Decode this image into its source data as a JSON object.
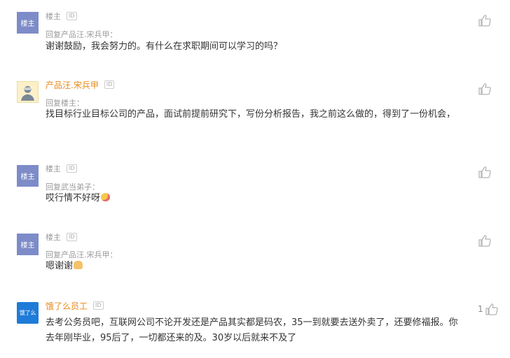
{
  "comments": [
    {
      "avatar_label": "楼主",
      "name": "楼主",
      "id_badge": "ID",
      "reply_to": "回复产品汪.宋兵甲：",
      "text": "谢谢鼓励，我会努力的。有什么在求职期间可以学习的吗？",
      "likes": ""
    },
    {
      "avatar_label": "",
      "name": "产品汪.宋兵甲",
      "id_badge": "ID",
      "reply_to": "回复楼主：",
      "text": "找目标行业目标公司的产品，面试前提前研究下，写份分析报告，我之前这么做的，得到了一份机会，",
      "likes": ""
    },
    {
      "avatar_label": "楼主",
      "name": "楼主",
      "id_badge": "ID",
      "reply_to": "回复武当弟子：",
      "text": "哎行情不好呀",
      "likes": ""
    },
    {
      "avatar_label": "楼主",
      "name": "楼主",
      "id_badge": "ID",
      "reply_to": "回复产品汪.宋兵甲：",
      "text": "嗯谢谢",
      "likes": ""
    },
    {
      "avatar_label": "饿了么",
      "name": "饿了么员工",
      "id_badge": "ID",
      "reply_to": "",
      "text": "去考公务员吧，互联网公司不论开发还是产品其实都是码农，35一到就要去送外卖了，还要修福报。你去年刚毕业，95后了，一切都还来的及。30岁以后就来不及了",
      "likes": "1"
    }
  ],
  "colors": {
    "host_avatar": "#7d8cc8",
    "orange_name": "#e88a17",
    "brand_blue": "#1f7bd8"
  },
  "icons": {
    "like": "thumbs-up-icon",
    "emoji_3": "pleading-face-icon",
    "emoji_4": "fist-bump-icon"
  }
}
